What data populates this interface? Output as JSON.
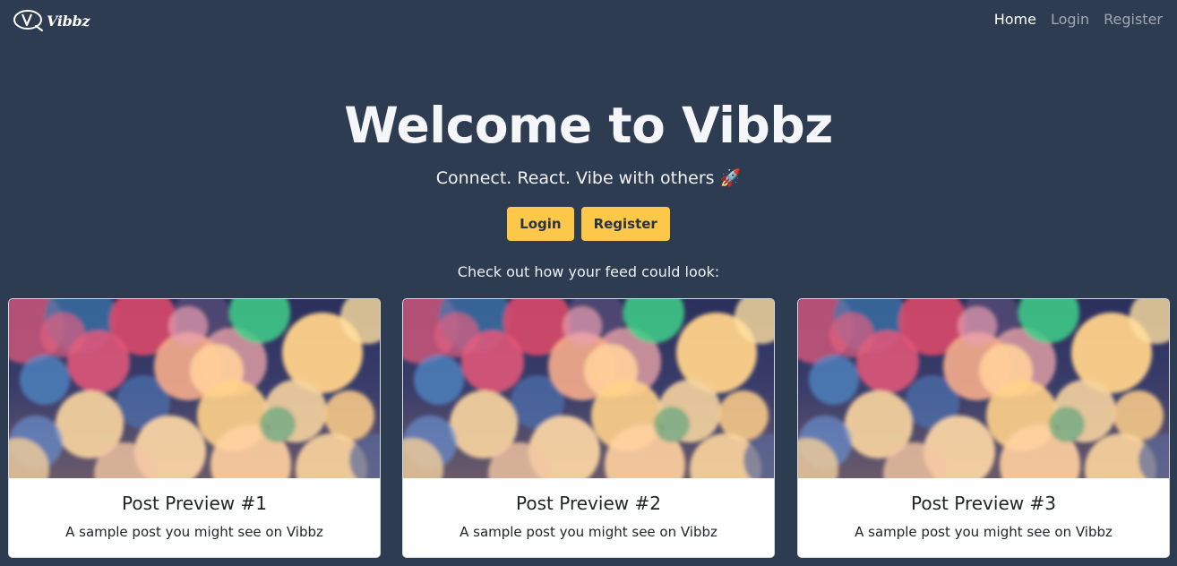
{
  "nav": {
    "brand": "Vibbz",
    "links": [
      {
        "label": "Home",
        "active": true
      },
      {
        "label": "Login",
        "active": false
      },
      {
        "label": "Register",
        "active": false
      }
    ]
  },
  "hero": {
    "title": "Welcome to Vibbz",
    "subtitle": "Connect. React. Vibe with others 🚀",
    "login_label": "Login",
    "register_label": "Register"
  },
  "feed": {
    "caption": "Check out how your feed could look:",
    "cards": [
      {
        "title": "Post Preview #1",
        "text": "A sample post you might see on Vibbz"
      },
      {
        "title": "Post Preview #2",
        "text": "A sample post you might see on Vibbz"
      },
      {
        "title": "Post Preview #3",
        "text": "A sample post you might see on Vibbz"
      }
    ]
  },
  "colors": {
    "background": "#2d3c50",
    "button": "#fdc74a",
    "card": "#ffffff"
  }
}
